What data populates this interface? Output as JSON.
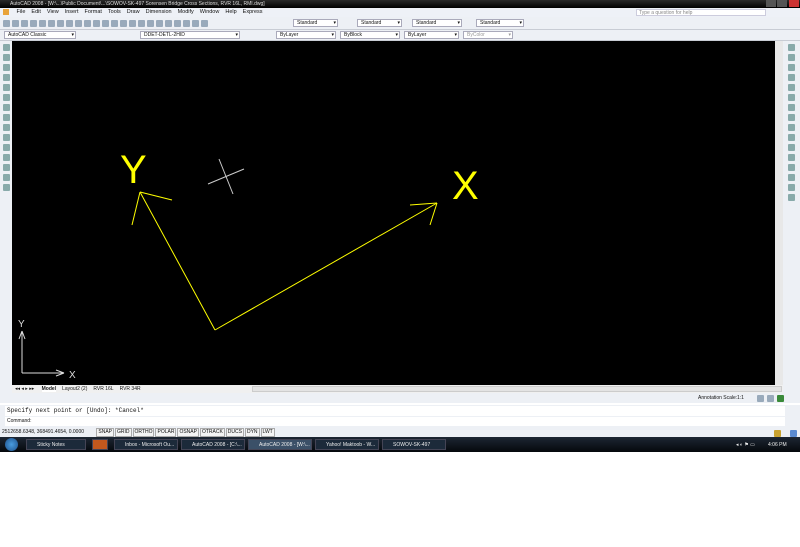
{
  "window": {
    "title": "AutoCAD 2008 - [W:\\...\\Public Document\\...\\SOWOV-SK-497 Sorensen Bridge Cross Sections, RVR 16L, RMI.dwg]",
    "help_placeholder": "Type a question for help"
  },
  "menu": [
    "File",
    "Edit",
    "View",
    "Insert",
    "Format",
    "Tools",
    "Draw",
    "Dimension",
    "Modify",
    "Window",
    "Help",
    "Express"
  ],
  "toolbar": {
    "text_style": "Standard",
    "dim_style": "Standard",
    "table_style": "Standard",
    "multileader_style": "Standard",
    "workspace": "AutoCAD Classic",
    "layer": "DDET-DETL-2HID",
    "color": "ByLayer",
    "linetype": "ByBlock",
    "lineweight": "ByLayer",
    "plotstyle": "ByColor"
  },
  "drawing": {
    "label_y": "Y",
    "label_x": "X",
    "ucs_y": "Y",
    "ucs_x": "X",
    "stroke": "#ffff00"
  },
  "tabs": [
    "Model",
    "Layout2 (2)",
    "RVR 16L",
    "RVR 34R"
  ],
  "annotation": {
    "label": "Annotation Scale:",
    "value": "1:1"
  },
  "command": {
    "history": "Specify next point or [Undo]: *Cancel*",
    "prompt": "Command:"
  },
  "status": {
    "coords": "2512658.6348, 368491.4654, 0.0000",
    "buttons": [
      "SNAP",
      "GRID",
      "ORTHO",
      "POLAR",
      "OSNAP",
      "OTRACK",
      "DUCS",
      "DYN",
      "LWT"
    ]
  },
  "taskbar": {
    "items": [
      "Sticky Notes",
      "",
      "Inbox - Microsoft Ou...",
      "AutoCAD 2008 - [C:\\...",
      "AutoCAD 2008 - [W:\\...",
      "Yahoo! Maktoob - W...",
      "SOWOV-SK-497"
    ],
    "time": "4:06 PM"
  }
}
